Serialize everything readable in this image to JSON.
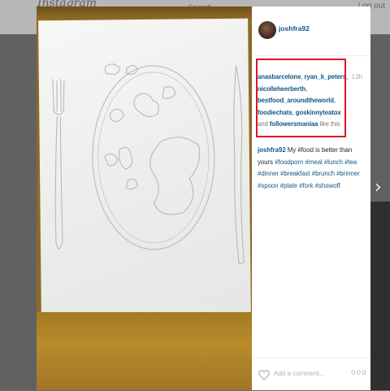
{
  "topbar": {
    "brand": "Instagram",
    "center_text": "Search",
    "right_link": "Log out"
  },
  "post": {
    "username": "joshfra92",
    "time_ago": "13h",
    "likes": {
      "users": [
        "anasbarcelone",
        "ryan_k_peters",
        "nicolleheerberth",
        "bestfood_aroundtheworld",
        "foodiechats",
        "goskinnyteatox"
      ],
      "connector": "and",
      "last_user": "followersmaniaa",
      "suffix": "like this"
    },
    "caption": {
      "username": "joshfra92",
      "text": "My #food is better than yours",
      "hashtags": "#foodporn #meal #lunch #tea #dinner #breakfast #brunch #brinner #spoon #plate #fork #showoff"
    },
    "comment_placeholder": "Add a comment...",
    "more_options": "ooo"
  },
  "nav": {
    "next": "›"
  },
  "colors": {
    "highlight_box": "#e0142a",
    "link": "#125688"
  }
}
